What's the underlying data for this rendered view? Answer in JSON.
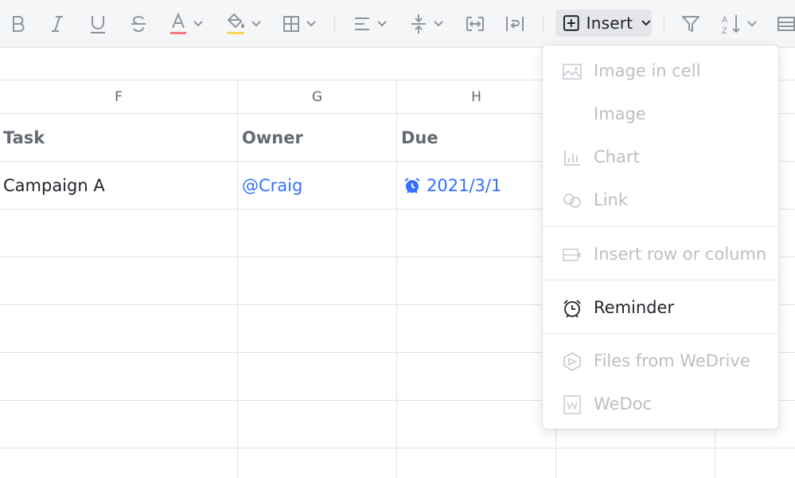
{
  "toolbar": {
    "insert_label": "Insert",
    "icons": [
      "bold-icon",
      "italic-icon",
      "underline-icon",
      "strikethrough-icon",
      "font-color-icon",
      "fill-color-icon",
      "borders-icon",
      "horizontal-align-icon",
      "vertical-align-icon",
      "merge-cells-icon",
      "wrap-text-icon",
      "insert-icon",
      "filter-icon",
      "sort-icon",
      "freeze-icon"
    ],
    "colors": {
      "font_color_bar": "#f07c82",
      "fill_color_bar": "#f7d65a"
    }
  },
  "sheet": {
    "columns": [
      "F",
      "G",
      "H"
    ],
    "header_row": [
      "Task",
      "Owner",
      "Due"
    ],
    "row1": {
      "task": "Campaign A",
      "owner": "@Craig",
      "due": "2021/3/1"
    },
    "accent": "#3370ff"
  },
  "menu": {
    "items": [
      {
        "label": "Image in cell",
        "enabled": false,
        "icon": "image-in-cell-icon"
      },
      {
        "label": "Image",
        "enabled": false,
        "icon": ""
      },
      {
        "label": "Chart",
        "enabled": false,
        "icon": "chart-icon"
      },
      {
        "label": "Link",
        "enabled": false,
        "icon": "link-icon"
      },
      {
        "label": "Insert row or column",
        "enabled": false,
        "icon": "insert-row-column-icon"
      },
      {
        "label": "Reminder",
        "enabled": true,
        "icon": "alarm-clock-icon"
      },
      {
        "label": "Files from WeDrive",
        "enabled": false,
        "icon": "wedrive-icon"
      },
      {
        "label": "WeDoc",
        "enabled": false,
        "icon": "wedoc-icon"
      }
    ]
  }
}
